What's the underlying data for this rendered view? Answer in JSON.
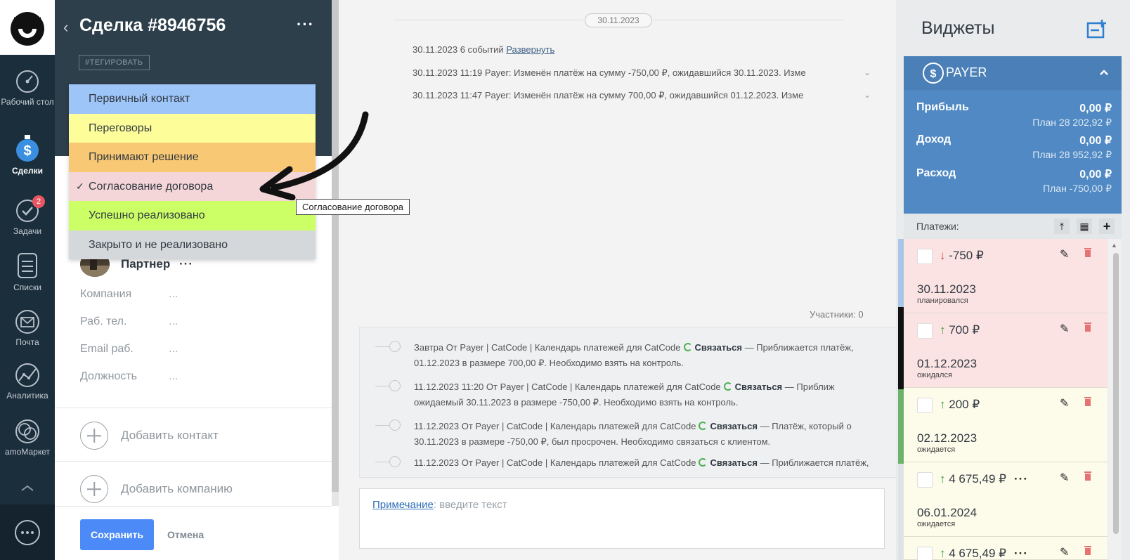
{
  "nav": {
    "items": [
      {
        "label": "Рабочий стол",
        "icon": "dashboard-icon"
      },
      {
        "label": "Сделки",
        "icon": "deals-icon"
      },
      {
        "label": "Задачи",
        "icon": "tasks-icon",
        "badge": "2"
      },
      {
        "label": "Списки",
        "icon": "lists-icon"
      },
      {
        "label": "Почта",
        "icon": "mail-icon"
      },
      {
        "label": "Аналитика",
        "icon": "analytics-icon"
      },
      {
        "label": "amoМаркет",
        "icon": "market-icon"
      }
    ]
  },
  "deal": {
    "title": "Сделка #8946756",
    "more": "···",
    "tag_button": "#ТЕГИРОВАТЬ",
    "partner": "Партнер",
    "partner_more": "···",
    "fields": [
      {
        "label": "Компания",
        "value": "..."
      },
      {
        "label": "Раб. тел.",
        "value": "..."
      },
      {
        "label": "Email раб.",
        "value": "..."
      },
      {
        "label": "Должность",
        "value": "..."
      }
    ],
    "add_contact": "Добавить контакт",
    "add_company": "Добавить компанию",
    "save": "Сохранить",
    "cancel": "Отмена"
  },
  "stages": {
    "items": [
      {
        "label": "Первичный контакт",
        "color": "#9ec5f8"
      },
      {
        "label": "Переговоры",
        "color": "#fdfd9a"
      },
      {
        "label": "Принимают решение",
        "color": "#f9c874"
      },
      {
        "label": "Согласование договора",
        "color": "#f5d6d8",
        "selected": true
      },
      {
        "label": "Успешно реализовано",
        "color": "#ccff66"
      },
      {
        "label": "Закрыто и не реализовано",
        "color": "#d5d8db"
      }
    ],
    "checkmark": "✓",
    "tooltip": "Согласование договора"
  },
  "feed": {
    "date": "30.11.2023",
    "summary_prefix": "30.11.2023 6 событий ",
    "summary_link": "Развернуть",
    "events": [
      "30.11.2023 11:19 Payer: Изменён платёж на сумму -750,00 ₽, ожидавшийся 30.11.2023. Изме",
      "30.11.2023 11:47 Payer: Изменён платёж на сумму 700,00 ₽, ожидавшийся 01.12.2023. Изме"
    ],
    "participants": "Участники: 0",
    "tasks": [
      {
        "head": "Завтра От Payer | CatCode | Календарь платежей для CatCode",
        "action": "Связаться",
        "tail": " — Приближается платёж,",
        "line2": "01.12.2023 в размере 700,00 ₽. Необходимо взять на контроль."
      },
      {
        "head": "11.12.2023 11:20 От Payer | CatCode | Календарь платежей для CatCode",
        "action": "Связаться",
        "tail": " — Приближ",
        "line2": "ожидаемый 30.11.2023 в размере -750,00 ₽. Необходимо взять на контроль."
      },
      {
        "head": "11.12.2023 От Payer | CatCode | Календарь платежей для CatCode",
        "action": "Связаться",
        "tail": " — Платёж, который о",
        "line2": "30.11.2023 в размере -750,00 ₽, был просрочен. Необходимо связаться с клиентом."
      },
      {
        "head": "11.12.2023 От Payer | CatCode | Календарь платежей для CatCode",
        "action": "Связаться",
        "tail": " — Приближается платёж,",
        "line2": ""
      }
    ],
    "note_link": "Примечание",
    "note_placeholder": ": введите текст"
  },
  "widgets": {
    "title": "Виджеты",
    "payer": {
      "name": "PAYER",
      "profit_label": "Прибыль",
      "profit_value": "0,00 ₽",
      "profit_plan": "План 28 202,92 ₽",
      "income_label": "Доход",
      "income_value": "0,00 ₽",
      "income_plan": "План 28 952,92 ₽",
      "expense_label": "Расход",
      "expense_value": "0,00 ₽",
      "expense_plan": "План -750,00 ₽",
      "payments_label": "Платежи:",
      "payments": [
        {
          "direction": "↓",
          "amount": "-750 ₽",
          "date": "30.11.2023",
          "status": "планировался",
          "bg": "#fbe3e3",
          "more": ""
        },
        {
          "direction": "↑",
          "amount": "700 ₽",
          "date": "01.12.2023",
          "status": "ожидался",
          "bg": "#fbe3e3",
          "more": ""
        },
        {
          "direction": "↑",
          "amount": "200 ₽",
          "date": "02.12.2023",
          "status": "ожидается",
          "bg": "#fdfbe9",
          "more": ""
        },
        {
          "direction": "↑",
          "amount": "4 675,49 ₽",
          "date": "06.01.2024",
          "status": "ожидается",
          "bg": "#fdfbe9",
          "more": "···"
        },
        {
          "direction": "↑",
          "amount": "4 675,49 ₽",
          "date": "",
          "status": "",
          "bg": "#fdfbe9",
          "more": "···"
        }
      ]
    }
  }
}
